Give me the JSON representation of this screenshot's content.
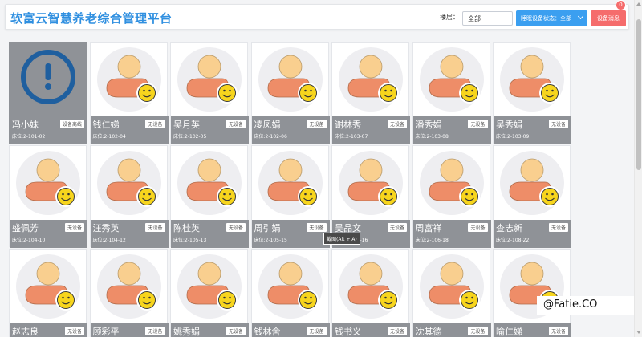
{
  "header": {
    "title": "软富云智慧养老综合管理平台",
    "floor_label": "楼层：",
    "floor_value": "全部",
    "status_filter_label": "睡眠设备状态：全部",
    "device_msg_label": "设备消息",
    "device_msg_count": "0"
  },
  "residents": [
    {
      "name": "冯小妹",
      "bed": "床位:2-101-02",
      "device": "设备离线",
      "status": "alert"
    },
    {
      "name": "钱仁娣",
      "bed": "床位:2-102-04",
      "device": "无设备",
      "status": "normal"
    },
    {
      "name": "吴月英",
      "bed": "床位:2-102-05",
      "device": "无设备",
      "status": "normal"
    },
    {
      "name": "凌凤娟",
      "bed": "床位:2-102-06",
      "device": "无设备",
      "status": "normal"
    },
    {
      "name": "谢林秀",
      "bed": "床位:2-103-07",
      "device": "无设备",
      "status": "normal"
    },
    {
      "name": "潘秀娟",
      "bed": "床位:2-103-08",
      "device": "无设备",
      "status": "normal"
    },
    {
      "name": "吴秀娟",
      "bed": "床位:2-103-09",
      "device": "无设备",
      "status": "normal"
    },
    {
      "name": "盛佩芳",
      "bed": "床位:2-104-10",
      "device": "无设备",
      "status": "normal"
    },
    {
      "name": "汪秀英",
      "bed": "床位:2-104-12",
      "device": "无设备",
      "status": "normal"
    },
    {
      "name": "陈桂英",
      "bed": "床位:2-105-13",
      "device": "无设备",
      "status": "normal"
    },
    {
      "name": "周引娟",
      "bed": "床位:2-105-15",
      "device": "无设备",
      "status": "normal"
    },
    {
      "name": "吴品文",
      "bed": "床位:2-106-16",
      "device": "无设备",
      "status": "normal"
    },
    {
      "name": "周富祥",
      "bed": "床位:2-106-18",
      "device": "无设备",
      "status": "normal"
    },
    {
      "name": "查志新",
      "bed": "床位:2-108-22",
      "device": "无设备",
      "status": "normal"
    },
    {
      "name": "赵志良",
      "bed": "",
      "device": "无设备",
      "status": "normal"
    },
    {
      "name": "顾彩平",
      "bed": "",
      "device": "无设备",
      "status": "normal"
    },
    {
      "name": "姚秀娟",
      "bed": "",
      "device": "无设备",
      "status": "normal"
    },
    {
      "name": "钱林舍",
      "bed": "",
      "device": "无设备",
      "status": "normal"
    },
    {
      "name": "钱书义",
      "bed": "",
      "device": "无设备",
      "status": "normal"
    },
    {
      "name": "沈其德",
      "bed": "",
      "device": "无设备",
      "status": "normal"
    },
    {
      "name": "喻仁娣",
      "bed": "",
      "device": "无设备",
      "status": "normal"
    }
  ],
  "tooltip": "截图(Alt + A)",
  "watermark": "@Fatie.CO",
  "colors": {
    "title": "#2f8fe0",
    "status_button": "#3b9ff0",
    "message_button": "#f56c6c",
    "info_bar": "#8f9297",
    "alert_icon": "#1f5f9f",
    "avatar_head": "#f9cf8f",
    "avatar_body": "#ee8d68",
    "smiley": "#f7d51d"
  },
  "icons": {
    "normal_avatar": "person-avatar-smiley-icon",
    "alert_avatar": "exclamation-alert-icon"
  }
}
